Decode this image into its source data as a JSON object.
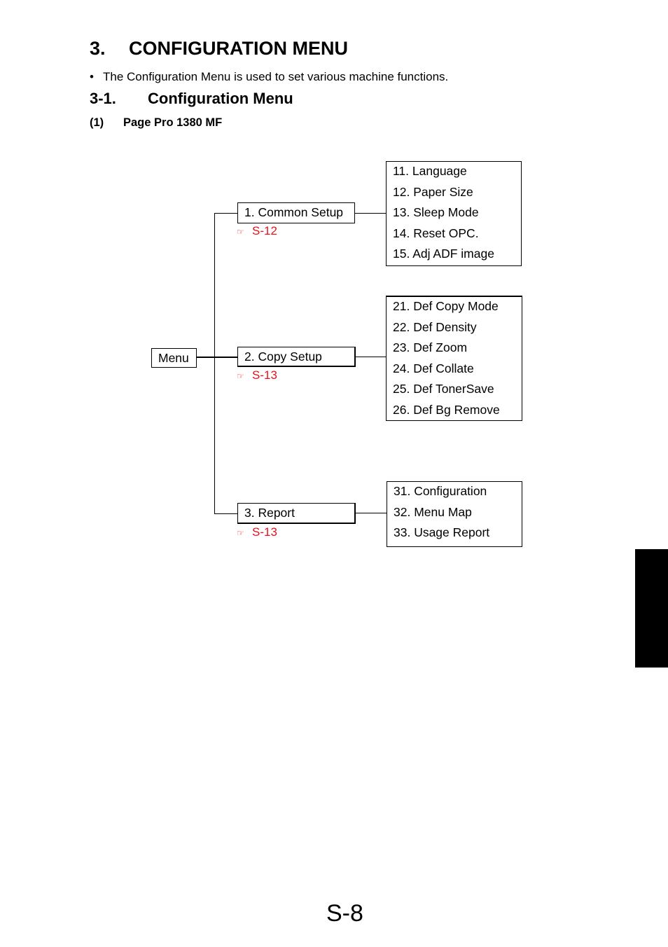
{
  "heading": {
    "number": "3.",
    "title": "CONFIGURATION MENU"
  },
  "intro_bullet": {
    "marker": "•",
    "text": "The Configuration Menu is used to set various machine functions."
  },
  "subheading": {
    "number": "3-1.",
    "title": "Configuration Menu"
  },
  "model_heading": {
    "number": "(1)",
    "title": "Page Pro 1380 MF"
  },
  "diagram": {
    "root": "Menu",
    "ref_icon": "pointing-hand-icon",
    "ref_color": "#e8101a",
    "branches": [
      {
        "label": "1. Common Setup",
        "ref": "S-12",
        "items": [
          "11. Language",
          "12. Paper Size",
          "13. Sleep Mode",
          "14. Reset OPC.",
          "15. Adj ADF image"
        ]
      },
      {
        "label": "2. Copy Setup",
        "ref": "S-13",
        "items": [
          "21. Def Copy Mode",
          "22. Def Density",
          "23. Def Zoom",
          "24. Def Collate",
          "25. Def TonerSave",
          "26. Def Bg Remove"
        ]
      },
      {
        "label": "3. Report",
        "ref": "S-13",
        "items": [
          "31. Configuration",
          "32. Menu Map",
          "33. Usage Report"
        ]
      }
    ]
  },
  "page_number": "S-8"
}
